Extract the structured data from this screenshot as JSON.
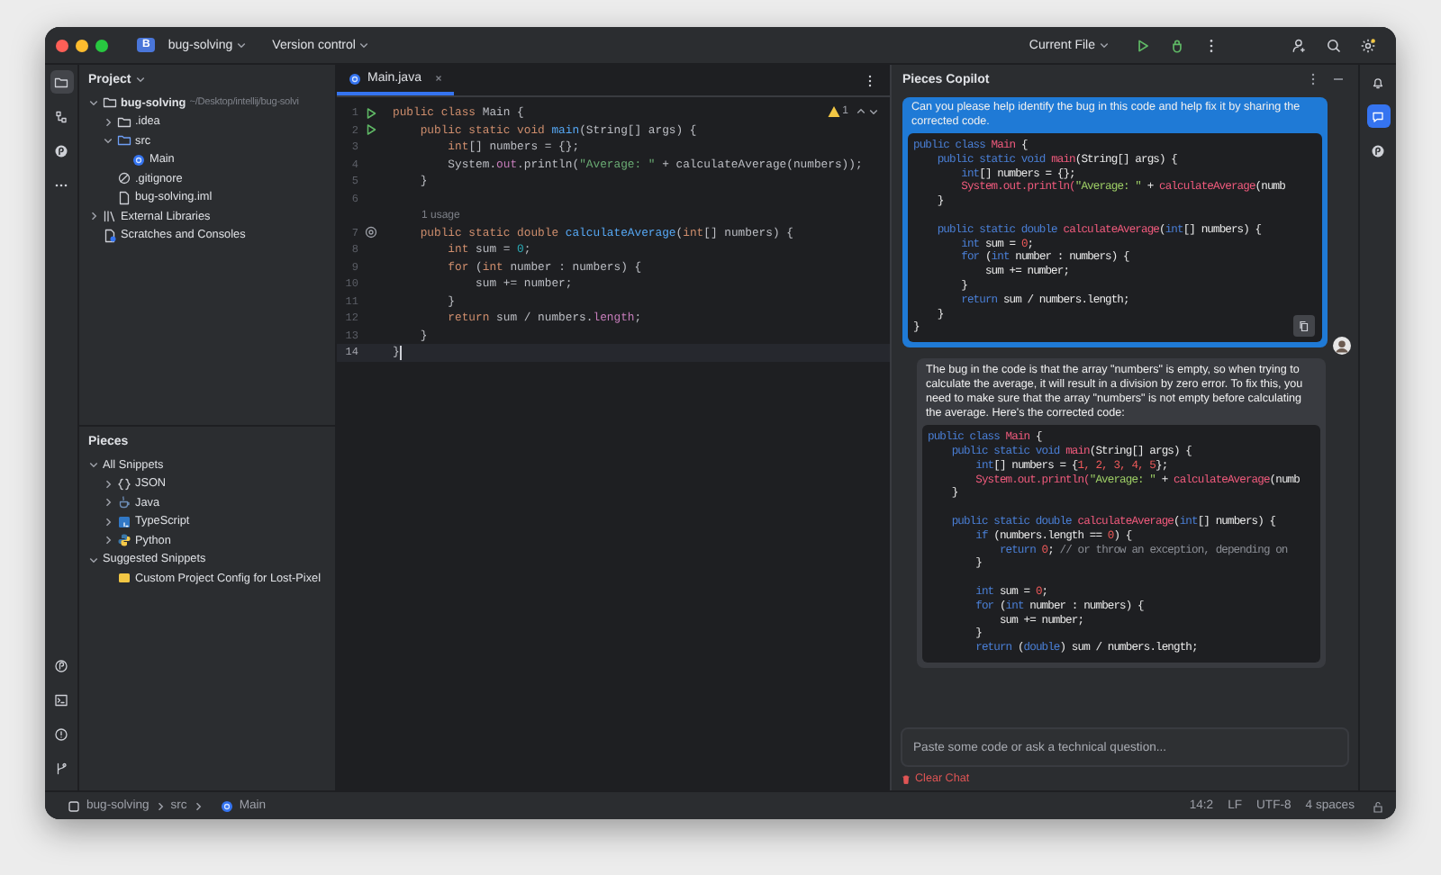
{
  "window": {
    "project_badge": "B",
    "project": "bug-solving",
    "vcs": "Version control",
    "run_config": "Current File"
  },
  "left_strip": {
    "top": [
      {
        "selected": true
      },
      {
        "selected": false
      },
      {
        "selected": false
      },
      {
        "selected": false
      }
    ],
    "bottom": [
      {
        "selected": false
      },
      {
        "selected": false
      },
      {
        "selected": false
      },
      {
        "selected": false
      }
    ]
  },
  "project": {
    "title": "Project",
    "tree": [
      {
        "label": "bug-solving",
        "kind": "folder",
        "note": "~/Desktop/intellij/bug-solvi",
        "expanded": true,
        "children": [
          {
            "label": ".idea",
            "kind": "folder",
            "expanded": false
          },
          {
            "label": "src",
            "kind": "source",
            "expanded": true,
            "children": [
              {
                "label": "Main",
                "kind": "class"
              }
            ]
          },
          {
            "label": ".gitignore",
            "kind": "ignore"
          },
          {
            "label": "bug-solving.iml",
            "kind": "file"
          }
        ]
      },
      {
        "label": "External Libraries",
        "kind": "library",
        "expanded": false
      },
      {
        "label": "Scratches and Consoles",
        "kind": "scratch"
      }
    ]
  },
  "pieces": {
    "title": "Pieces",
    "tree": [
      {
        "label": "All Snippets",
        "expanded": true,
        "children": [
          {
            "label": "JSON",
            "kind": "json",
            "expanded": false
          },
          {
            "label": "Java",
            "kind": "java",
            "expanded": false
          },
          {
            "label": "TypeScript",
            "kind": "typescript",
            "expanded": false
          },
          {
            "label": "Python",
            "kind": "python",
            "expanded": false
          }
        ]
      },
      {
        "label": "Suggested Snippets",
        "expanded": true,
        "children": [
          {
            "label": "Custom Project Config for Lost-Pixel",
            "kind": "snippet"
          }
        ]
      }
    ]
  },
  "editor": {
    "tabs": [
      {
        "label": "Main.java",
        "selected": true
      }
    ],
    "warnings": "1",
    "lines": [
      {
        "n": "1",
        "kind": "run",
        "current": false,
        "tokens": [
          {
            "kind": "keyword",
            "text": "public class "
          },
          {
            "kind": "plain",
            "text": "Main {"
          }
        ]
      },
      {
        "n": "2",
        "kind": "run",
        "current": false,
        "tokens": [
          {
            "kind": "keyword",
            "text": "    public static void "
          },
          {
            "kind": "function",
            "text": "main"
          },
          {
            "kind": "plain",
            "text": "(String[] args) {"
          }
        ]
      },
      {
        "n": "3",
        "kind": "code",
        "current": false,
        "tokens": [
          {
            "kind": "keyword",
            "text": "        int"
          },
          {
            "kind": "plain",
            "text": "[] numbers = {};"
          }
        ]
      },
      {
        "n": "4",
        "kind": "code",
        "current": false,
        "tokens": [
          {
            "kind": "plain",
            "text": "        System."
          },
          {
            "kind": "field",
            "text": "out"
          },
          {
            "kind": "plain",
            "text": ".println("
          },
          {
            "kind": "string",
            "text": "\"Average: \""
          },
          {
            "kind": "plain",
            "text": " + calculateAverage(numbers));"
          }
        ]
      },
      {
        "n": "5",
        "kind": "code",
        "current": false,
        "tokens": [
          {
            "kind": "plain",
            "text": "    }"
          }
        ]
      },
      {
        "n": "6",
        "kind": "code",
        "current": false
      },
      {
        "kind": "hint",
        "text": "1 usage"
      },
      {
        "n": "7",
        "kind": "override",
        "current": false,
        "tokens": [
          {
            "kind": "keyword",
            "text": "    public static double "
          },
          {
            "kind": "function",
            "text": "calculateAverage"
          },
          {
            "kind": "plain",
            "text": "("
          },
          {
            "kind": "keyword",
            "text": "int"
          },
          {
            "kind": "plain",
            "text": "[] numbers) {"
          }
        ]
      },
      {
        "n": "8",
        "kind": "code",
        "current": false,
        "tokens": [
          {
            "kind": "keyword",
            "text": "        int "
          },
          {
            "kind": "plain",
            "text": "sum = "
          },
          {
            "kind": "number",
            "text": "0"
          },
          {
            "kind": "plain",
            "text": ";"
          }
        ]
      },
      {
        "n": "9",
        "kind": "code",
        "current": false,
        "tokens": [
          {
            "kind": "keyword",
            "text": "        for "
          },
          {
            "kind": "plain",
            "text": "("
          },
          {
            "kind": "keyword",
            "text": "int "
          },
          {
            "kind": "plain",
            "text": "number : numbers) {"
          }
        ]
      },
      {
        "n": "10",
        "kind": "code",
        "current": false,
        "tokens": [
          {
            "kind": "plain",
            "text": "            sum += number;"
          }
        ]
      },
      {
        "n": "11",
        "kind": "code",
        "current": false,
        "tokens": [
          {
            "kind": "plain",
            "text": "        }"
          }
        ]
      },
      {
        "n": "12",
        "kind": "code",
        "current": false,
        "tokens": [
          {
            "kind": "keyword",
            "text": "        return "
          },
          {
            "kind": "plain",
            "text": "sum / numbers."
          },
          {
            "kind": "field",
            "text": "length"
          },
          {
            "kind": "plain",
            "text": ";"
          }
        ]
      },
      {
        "n": "13",
        "kind": "code",
        "current": false,
        "tokens": [
          {
            "kind": "plain",
            "text": "    }"
          }
        ]
      },
      {
        "n": "14",
        "kind": "code",
        "current": true,
        "tokens": [
          {
            "kind": "plain",
            "text": "}"
          }
        ]
      }
    ]
  },
  "copilot": {
    "title": "Pieces Copilot",
    "messages": [
      {
        "kind": "question",
        "text": "Can you please help identify the bug in this code and help fix it by sharing the corrected code.",
        "code": [
          {
            "kind": "code",
            "tokens": [
              {
                "kind": "keyword",
                "text": "public class "
              },
              {
                "kind": "function",
                "text": "Main"
              },
              {
                "kind": "plain",
                "text": " {"
              }
            ]
          },
          {
            "kind": "code",
            "tokens": [
              {
                "kind": "keyword",
                "text": "    public static void "
              },
              {
                "kind": "function",
                "text": "main"
              },
              {
                "kind": "plain",
                "text": "(String[] args) {"
              }
            ]
          },
          {
            "kind": "code",
            "tokens": [
              {
                "kind": "keyword",
                "text": "        int"
              },
              {
                "kind": "plain",
                "text": "[] numbers = {};"
              }
            ]
          },
          {
            "kind": "code",
            "tokens": [
              {
                "kind": "function",
                "text": "        System.out.println("
              },
              {
                "kind": "string",
                "text": "\"Average: \""
              },
              {
                "kind": "plain",
                "text": " + "
              },
              {
                "kind": "function",
                "text": "calculateAverage"
              },
              {
                "kind": "plain",
                "text": "(numb"
              }
            ]
          },
          {
            "kind": "code",
            "tokens": [
              {
                "kind": "plain",
                "text": "    }"
              }
            ]
          },
          {
            "kind": "blank"
          },
          {
            "kind": "code",
            "tokens": [
              {
                "kind": "keyword",
                "text": "    public static double "
              },
              {
                "kind": "function",
                "text": "calculateAverage"
              },
              {
                "kind": "plain",
                "text": "("
              },
              {
                "kind": "keyword",
                "text": "int"
              },
              {
                "kind": "plain",
                "text": "[] numbers) {"
              }
            ]
          },
          {
            "kind": "code",
            "tokens": [
              {
                "kind": "keyword",
                "text": "        int "
              },
              {
                "kind": "plain",
                "text": "sum = "
              },
              {
                "kind": "number",
                "text": "0"
              },
              {
                "kind": "plain",
                "text": ";"
              }
            ]
          },
          {
            "kind": "code",
            "tokens": [
              {
                "kind": "keyword",
                "text": "        for "
              },
              {
                "kind": "plain",
                "text": "("
              },
              {
                "kind": "keyword",
                "text": "int "
              },
              {
                "kind": "plain",
                "text": "number : numbers) {"
              }
            ]
          },
          {
            "kind": "code",
            "tokens": [
              {
                "kind": "plain",
                "text": "            sum += number;"
              }
            ]
          },
          {
            "kind": "code",
            "tokens": [
              {
                "kind": "plain",
                "text": "        }"
              }
            ]
          },
          {
            "kind": "code",
            "tokens": [
              {
                "kind": "keyword",
                "text": "        return "
              },
              {
                "kind": "plain",
                "text": "sum / numbers.length;"
              }
            ]
          },
          {
            "kind": "code",
            "tokens": [
              {
                "kind": "plain",
                "text": "    }"
              }
            ]
          },
          {
            "kind": "code",
            "tokens": [
              {
                "kind": "plain",
                "text": "}"
              }
            ]
          }
        ]
      },
      {
        "kind": "answer",
        "text": "The bug in the code is that the array \"numbers\" is empty, so when trying to calculate the average, it will result in a division by zero error. To fix this, you need to make sure that the array \"numbers\" is not empty before calculating the average. Here's the corrected code:",
        "code": [
          {
            "kind": "code",
            "tokens": [
              {
                "kind": "keyword",
                "text": "public class "
              },
              {
                "kind": "function",
                "text": "Main"
              },
              {
                "kind": "plain",
                "text": " {"
              }
            ]
          },
          {
            "kind": "code",
            "tokens": [
              {
                "kind": "keyword",
                "text": "    public static void "
              },
              {
                "kind": "function",
                "text": "main"
              },
              {
                "kind": "plain",
                "text": "(String[] args) {"
              }
            ]
          },
          {
            "kind": "code",
            "tokens": [
              {
                "kind": "keyword",
                "text": "        int"
              },
              {
                "kind": "plain",
                "text": "[] numbers = {"
              },
              {
                "kind": "number",
                "text": "1, 2, 3, 4, 5"
              },
              {
                "kind": "plain",
                "text": "};"
              }
            ]
          },
          {
            "kind": "code",
            "tokens": [
              {
                "kind": "function",
                "text": "        System.out.println("
              },
              {
                "kind": "string",
                "text": "\"Average: \""
              },
              {
                "kind": "plain",
                "text": " + "
              },
              {
                "kind": "function",
                "text": "calculateAverage"
              },
              {
                "kind": "plain",
                "text": "(numb"
              }
            ]
          },
          {
            "kind": "code",
            "tokens": [
              {
                "kind": "plain",
                "text": "    }"
              }
            ]
          },
          {
            "kind": "blank"
          },
          {
            "kind": "code",
            "tokens": [
              {
                "kind": "keyword",
                "text": "    public static double "
              },
              {
                "kind": "function",
                "text": "calculateAverage"
              },
              {
                "kind": "plain",
                "text": "("
              },
              {
                "kind": "keyword",
                "text": "int"
              },
              {
                "kind": "plain",
                "text": "[] numbers) {"
              }
            ]
          },
          {
            "kind": "code",
            "tokens": [
              {
                "kind": "keyword",
                "text": "        if "
              },
              {
                "kind": "plain",
                "text": "(numbers.length == "
              },
              {
                "kind": "number",
                "text": "0"
              },
              {
                "kind": "plain",
                "text": ") {"
              }
            ]
          },
          {
            "kind": "code",
            "tokens": [
              {
                "kind": "keyword",
                "text": "            return "
              },
              {
                "kind": "number",
                "text": "0"
              },
              {
                "kind": "plain",
                "text": "; "
              },
              {
                "kind": "comment",
                "text": "// or throw an exception, depending on"
              }
            ]
          },
          {
            "kind": "code",
            "tokens": [
              {
                "kind": "plain",
                "text": "        }"
              }
            ]
          },
          {
            "kind": "blank"
          },
          {
            "kind": "code",
            "tokens": [
              {
                "kind": "keyword",
                "text": "        int "
              },
              {
                "kind": "plain",
                "text": "sum = "
              },
              {
                "kind": "number",
                "text": "0"
              },
              {
                "kind": "plain",
                "text": ";"
              }
            ]
          },
          {
            "kind": "code",
            "tokens": [
              {
                "kind": "keyword",
                "text": "        for "
              },
              {
                "kind": "plain",
                "text": "("
              },
              {
                "kind": "keyword",
                "text": "int "
              },
              {
                "kind": "plain",
                "text": "number : numbers) {"
              }
            ]
          },
          {
            "kind": "code",
            "tokens": [
              {
                "kind": "plain",
                "text": "            sum += number;"
              }
            ]
          },
          {
            "kind": "code",
            "tokens": [
              {
                "kind": "plain",
                "text": "        }"
              }
            ]
          },
          {
            "kind": "code",
            "tokens": [
              {
                "kind": "keyword",
                "text": "        return "
              },
              {
                "kind": "plain",
                "text": "("
              },
              {
                "kind": "keyword",
                "text": "double"
              },
              {
                "kind": "plain",
                "text": ") sum / numbers.length;"
              }
            ]
          }
        ]
      }
    ],
    "input": {
      "placeholder": "Paste some code or ask a technical question..."
    },
    "clear": "Clear Chat"
  },
  "right_strip": [
    {
      "selected": false
    },
    {
      "selected": true
    },
    {
      "selected": false
    }
  ],
  "status_bar": {
    "breadcrumbs": [
      {
        "label": "bug-solving",
        "kind": "module"
      },
      {
        "label": "src",
        "kind": "folder"
      },
      {
        "label": "Main",
        "kind": "class"
      }
    ],
    "position": "14:2",
    "line_ending": "LF",
    "encoding": "UTF-8",
    "indent": "4 spaces"
  }
}
